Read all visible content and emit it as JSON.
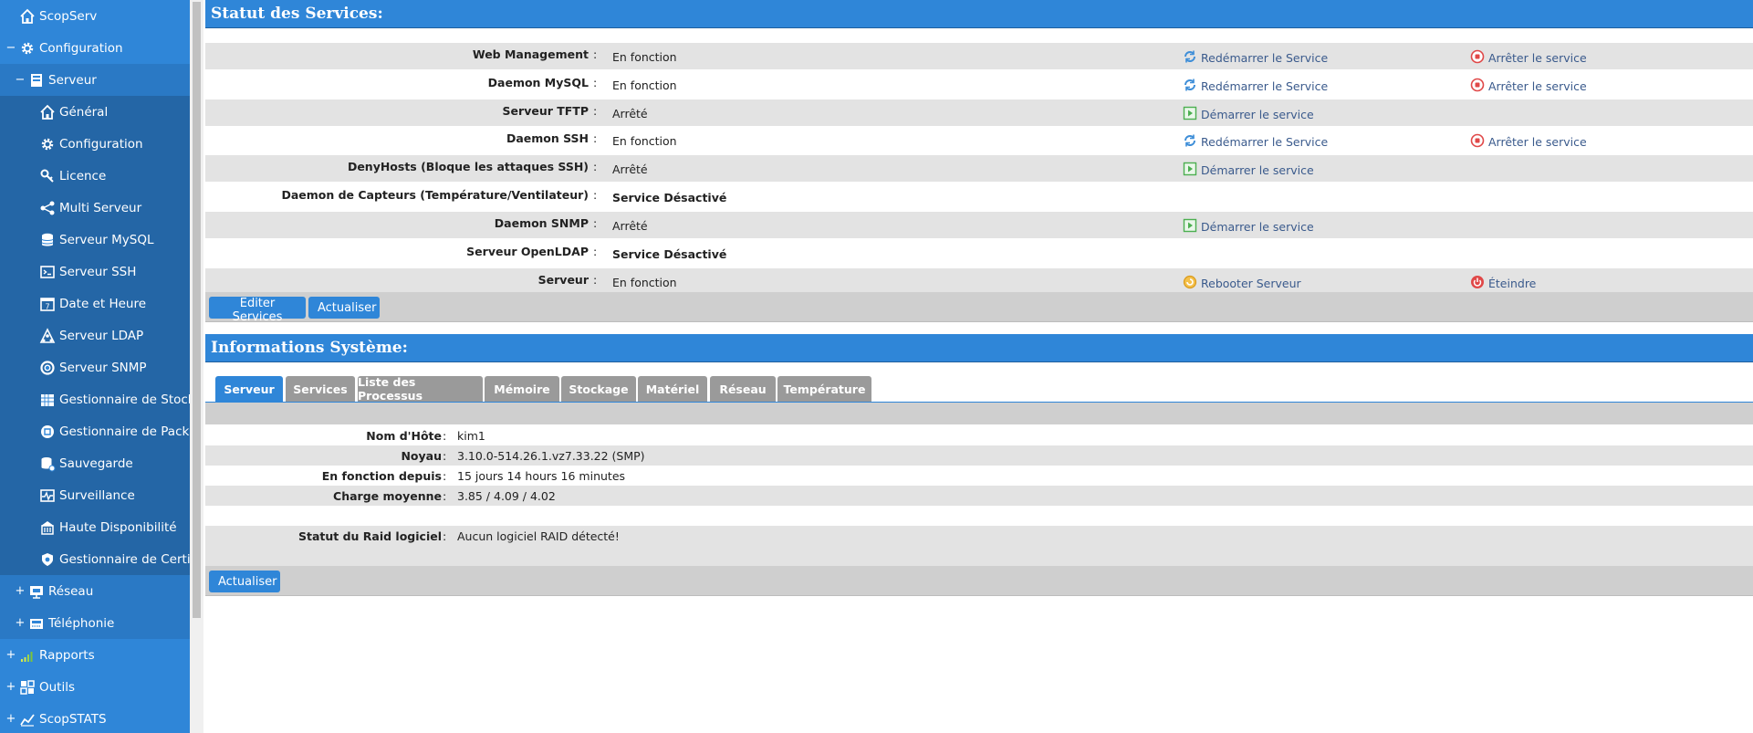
{
  "sidebar": {
    "items": [
      {
        "label": "ScopServ",
        "exp": "",
        "icon": "home-icon"
      },
      {
        "label": "Configuration",
        "exp": "−",
        "icon": "gear-icon"
      },
      {
        "label": "Serveur",
        "exp": "−",
        "icon": "server-icon"
      },
      {
        "label": "Général",
        "exp": "",
        "icon": "home-icon"
      },
      {
        "label": "Configuration",
        "exp": "",
        "icon": "gear-icon"
      },
      {
        "label": "Licence",
        "exp": "",
        "icon": "key-icon"
      },
      {
        "label": "Multi Serveur",
        "exp": "",
        "icon": "share-icon"
      },
      {
        "label": "Serveur MySQL",
        "exp": "",
        "icon": "database-icon"
      },
      {
        "label": "Serveur SSH",
        "exp": "",
        "icon": "terminal-icon"
      },
      {
        "label": "Date et Heure",
        "exp": "",
        "icon": "calendar-icon"
      },
      {
        "label": "Serveur LDAP",
        "exp": "",
        "icon": "ldap-icon"
      },
      {
        "label": "Serveur SNMP",
        "exp": "",
        "icon": "lifebuoy-icon"
      },
      {
        "label": "Gestionnaire de Stockage",
        "exp": "",
        "icon": "storage-icon"
      },
      {
        "label": "Gestionnaire de Packages",
        "exp": "",
        "icon": "package-icon"
      },
      {
        "label": "Sauvegarde",
        "exp": "",
        "icon": "backup-icon"
      },
      {
        "label": "Surveillance",
        "exp": "",
        "icon": "pulse-icon"
      },
      {
        "label": "Haute Disponibilité",
        "exp": "",
        "icon": "building-icon"
      },
      {
        "label": "Gestionnaire de Certificats",
        "exp": "",
        "icon": "certificate-icon"
      },
      {
        "label": "Réseau",
        "exp": "+",
        "icon": "network-icon"
      },
      {
        "label": "Téléphonie",
        "exp": "+",
        "icon": "phone-icon"
      },
      {
        "label": "Rapports",
        "exp": "+",
        "icon": "bar-chart-icon"
      },
      {
        "label": "Outils",
        "exp": "+",
        "icon": "tools-icon"
      },
      {
        "label": "ScopSTATS",
        "exp": "+",
        "icon": "stats-icon"
      }
    ]
  },
  "services": {
    "title": "Statut des Services:",
    "rows": [
      {
        "name": "Web Management",
        "status": "En fonction",
        "status_bold": false,
        "act1": "Redémarrer le Service",
        "act1_icon": "restart-icon",
        "act2": "Arrêter le service",
        "act2_icon": "stop-icon"
      },
      {
        "name": "Daemon MySQL",
        "status": "En fonction",
        "status_bold": false,
        "act1": "Redémarrer le Service",
        "act1_icon": "restart-icon",
        "act2": "Arrêter le service",
        "act2_icon": "stop-icon"
      },
      {
        "name": "Serveur TFTP",
        "status": "Arrêté",
        "status_bold": false,
        "act1": "Démarrer le service",
        "act1_icon": "start-icon",
        "act2": "",
        "act2_icon": ""
      },
      {
        "name": "Daemon SSH",
        "status": "En fonction",
        "status_bold": false,
        "act1": "Redémarrer le Service",
        "act1_icon": "restart-icon",
        "act2": "Arrêter le service",
        "act2_icon": "stop-icon"
      },
      {
        "name": "DenyHosts (Bloque les attaques SSH)",
        "status": "Arrêté",
        "status_bold": false,
        "act1": "Démarrer le service",
        "act1_icon": "start-icon",
        "act2": "",
        "act2_icon": ""
      },
      {
        "name": "Daemon de Capteurs (Température/Ventilateur)",
        "status": "Service Désactivé",
        "status_bold": true,
        "act1": "",
        "act1_icon": "",
        "act2": "",
        "act2_icon": ""
      },
      {
        "name": "Daemon SNMP",
        "status": "Arrêté",
        "status_bold": false,
        "act1": "Démarrer le service",
        "act1_icon": "start-icon",
        "act2": "",
        "act2_icon": ""
      },
      {
        "name": "Serveur OpenLDAP",
        "status": "Service Désactivé",
        "status_bold": true,
        "act1": "",
        "act1_icon": "",
        "act2": "",
        "act2_icon": ""
      },
      {
        "name": "Serveur",
        "status": "En fonction",
        "status_bold": false,
        "act1": "Rebooter Serveur",
        "act1_icon": "reboot-icon",
        "act2": "Éteindre",
        "act2_icon": "power-icon"
      }
    ],
    "edit_button": "Editer Services",
    "refresh_button": "Actualiser"
  },
  "sysinfo": {
    "title": "Informations Système:",
    "tabs": [
      "Serveur",
      "Services",
      "Liste des Processus",
      "Mémoire",
      "Stockage",
      "Matériel",
      "Réseau",
      "Température"
    ],
    "active_tab": "Serveur",
    "rows": [
      {
        "label": "Nom d'Hôte",
        "value": "kim1"
      },
      {
        "label": "Noyau",
        "value": "3.10.0-514.26.1.vz7.33.22 (SMP)"
      },
      {
        "label": "En fonction depuis",
        "value": "15 jours 14 hours 16 minutes"
      },
      {
        "label": "Charge moyenne",
        "value": "3.85 / 4.09 / 4.02"
      },
      {
        "label": "",
        "value": ""
      },
      {
        "label": "Statut du Raid logiciel",
        "value": "Aucun logiciel RAID détecté!"
      }
    ],
    "refresh_button": "Actualiser"
  },
  "colors": {
    "accent": "#2f86d8",
    "row_shade": "#e3e3e3",
    "action_text": "#3a5a8c"
  }
}
